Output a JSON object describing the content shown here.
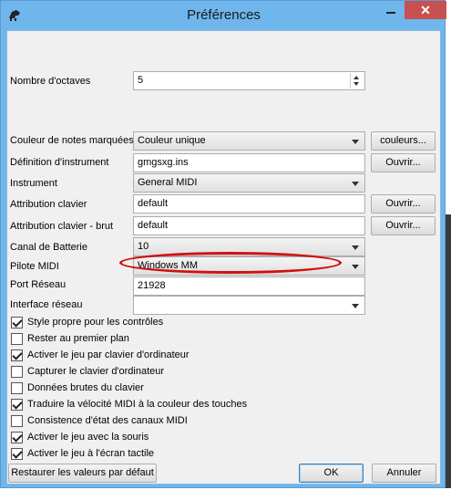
{
  "window": {
    "title": "Préférences",
    "close_glyph": "✕"
  },
  "octaves": {
    "label": "Nombre d'octaves",
    "value": "5"
  },
  "rows": {
    "note_color": {
      "label": "Couleur de notes marquées",
      "value": "Couleur unique",
      "button": "couleurs..."
    },
    "instrument_def": {
      "label": "Définition d'instrument",
      "value": "gmgsxg.ins",
      "button": "Ouvrir..."
    },
    "instrument": {
      "label": "Instrument",
      "value": "General MIDI"
    },
    "keyboard_map": {
      "label": "Attribution clavier",
      "value": "default",
      "button": "Ouvrir..."
    },
    "keyboard_map_raw": {
      "label": "Attribution clavier - brut",
      "value": "default",
      "button": "Ouvrir..."
    },
    "drum_channel": {
      "label": "Canal de Batterie",
      "value": "10"
    },
    "midi_driver": {
      "label": "Pilote MIDI",
      "value": "Windows MM"
    },
    "net_port": {
      "label": "Port Réseau",
      "value": "21928"
    },
    "net_iface": {
      "label": "Interface réseau",
      "value": ""
    }
  },
  "checkboxes": [
    {
      "label": "Style propre pour les contrôles",
      "checked": true
    },
    {
      "label": "Rester au premier plan",
      "checked": false
    },
    {
      "label": "Activer le jeu par clavier d'ordinateur",
      "checked": true
    },
    {
      "label": "Capturer le clavier d'ordinateur",
      "checked": false
    },
    {
      "label": "Données brutes du clavier",
      "checked": false
    },
    {
      "label": "Traduire la vélocité MIDI à la couleur des touches",
      "checked": true
    },
    {
      "label": "Consistence d'état des canaux MIDI",
      "checked": false
    },
    {
      "label": "Activer le jeu avec la souris",
      "checked": true
    },
    {
      "label": "Activer le jeu à l'écran tactile",
      "checked": true
    }
  ],
  "buttons": {
    "restore": "Restaurer les valeurs par défaut",
    "ok": "OK",
    "cancel": "Annuler"
  },
  "colors": {
    "title_bar": "#6fb6ec",
    "close_button": "#c75050",
    "highlight_ellipse": "#d01010"
  }
}
